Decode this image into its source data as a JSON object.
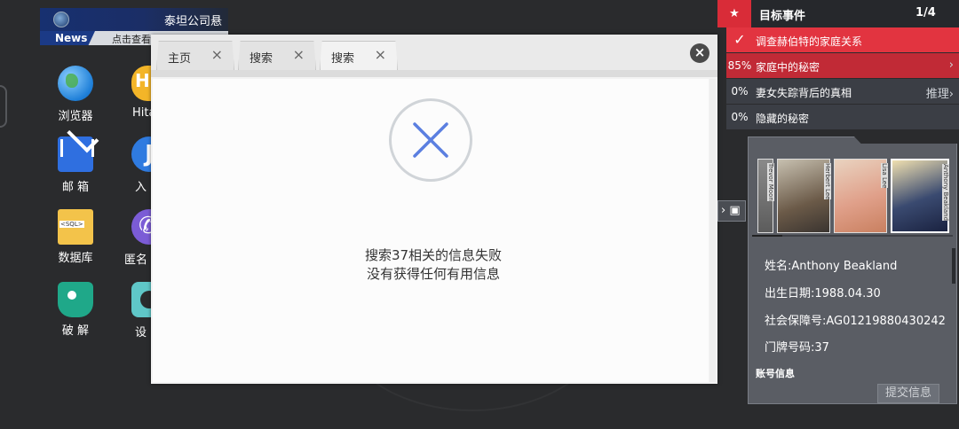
{
  "news": {
    "title": "泰坦公司悬",
    "tag": "News",
    "subtitle": "点击查看"
  },
  "desktop": {
    "apps": [
      {
        "label": "浏览器",
        "icon": "globe-icon"
      },
      {
        "label": "Hita",
        "icon": "hita-icon"
      },
      {
        "label": "邮 箱",
        "icon": "mail-icon"
      },
      {
        "label": "入",
        "icon": "j-app-icon"
      },
      {
        "label": "数据库",
        "icon": "sql-database-icon"
      },
      {
        "label": "匿名",
        "icon": "phone-icon"
      },
      {
        "label": "破 解",
        "icon": "shield-lock-icon"
      },
      {
        "label": "设",
        "icon": "gear-icon"
      }
    ],
    "sql_text": "<SQL>",
    "hita_letter": "H",
    "j_letter": "J"
  },
  "browser": {
    "tabs": [
      {
        "label": "主页",
        "close": "×"
      },
      {
        "label": "搜索",
        "close": "×"
      },
      {
        "label": "搜索",
        "close": "×"
      }
    ],
    "active_tab": 2,
    "close_symbol": "×",
    "message_line1": "搜索37相关的信息失败",
    "message_line2": "没有获得任何有用信息",
    "fail_color": "#5b7fe0"
  },
  "objectives": {
    "title": "目标事件",
    "count": "1/4",
    "star": "★",
    "items": [
      {
        "pct": "✓",
        "label": "调查赫伯特的家庭关系",
        "right": "",
        "bg": "#e23440"
      },
      {
        "pct": "85%",
        "label": "家庭中的秘密",
        "right": "›",
        "bg": "#c12a36"
      },
      {
        "pct": "0%",
        "label": "妻女失踪背后的真相",
        "right": "推理›",
        "bg": "#3b3e45"
      },
      {
        "pct": "0%",
        "label": "隐藏的秘密",
        "right": "",
        "bg": "#3b3e45"
      }
    ]
  },
  "profile": {
    "photo_names": [
      "Trevor Moon",
      "Herbert Lee",
      "Lisa Lee",
      "Anthony Beakland"
    ],
    "name": "姓名:Anthony Beakland",
    "birth": "出生日期:1988.04.30",
    "ssn": "社会保障号:AG01219880430242",
    "door": "门牌号码:37",
    "account_label": "账号信息",
    "submit": "提交信息",
    "tab_glyph": "›"
  }
}
